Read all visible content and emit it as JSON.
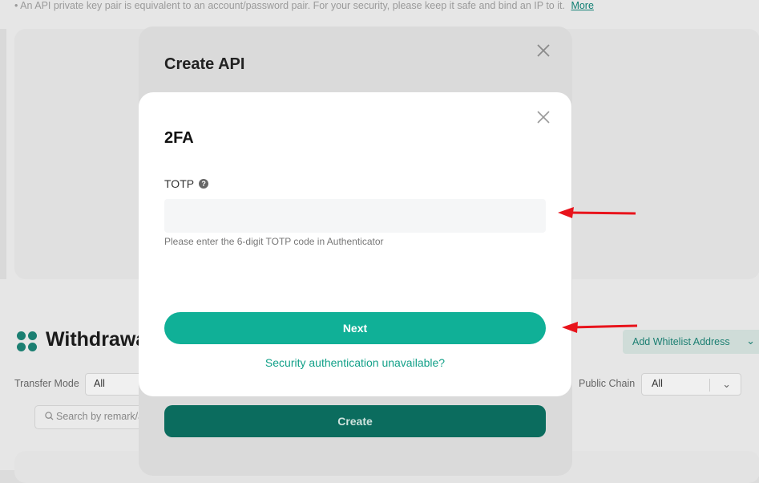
{
  "background": {
    "notice_text": "• An API private key pair is equivalent to an account/password pair. For your security, please keep it safe and bind an IP to it.",
    "notice_link": "More",
    "withdrawal_title": "Withdrawal",
    "add_whitelist_label": "Add Whitelist Address",
    "transfer_mode_label": "Transfer Mode",
    "transfer_mode_value": "All",
    "public_chain_label": "Public Chain",
    "public_chain_value": "All",
    "search_placeholder": "Search by remark/a",
    "create_api_title": "Create API",
    "create_button_label": "Create"
  },
  "modal": {
    "title": "2FA",
    "field_label": "TOTP",
    "totp_value": "",
    "hint": "Please enter the 6-digit TOTP code in Authenticator",
    "next_label": "Next",
    "unavailable_link": "Security authentication unavailable?"
  },
  "colors": {
    "primary": "#10b097",
    "dark_primary": "#0b6c5e",
    "annotation_arrow": "#e8141c"
  },
  "icons": [
    "close-icon",
    "help-icon",
    "withdrawal-icon",
    "chevron-down-icon",
    "search-icon"
  ]
}
